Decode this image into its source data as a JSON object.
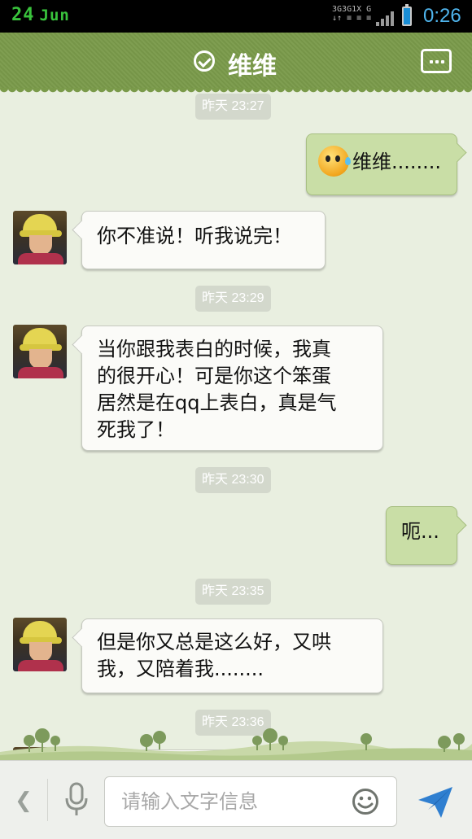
{
  "status_bar": {
    "day": "24",
    "month": "Jun",
    "network": [
      "3G",
      "3G",
      "1X",
      "G"
    ],
    "time": "0:26"
  },
  "header": {
    "title": "维维",
    "verified_icon": "check-circle-icon",
    "menu_icon": "more-dots-icon"
  },
  "messages": [
    {
      "type": "timestamp",
      "text": "昨天 23:27"
    },
    {
      "type": "out",
      "text": "维维........",
      "emoji": "sweat-face-emoji"
    },
    {
      "type": "in",
      "text": "你不准说！听我说完！"
    },
    {
      "type": "timestamp",
      "text": "昨天 23:29"
    },
    {
      "type": "in",
      "lines": [
        "当你跟我表白的时候，我真",
        "的很开心！可是你这个笨蛋",
        "居然是在qq上表白，真是气",
        "死我了！"
      ]
    },
    {
      "type": "timestamp",
      "text": "昨天 23:30"
    },
    {
      "type": "out",
      "text": "呃..."
    },
    {
      "type": "timestamp",
      "text": "昨天 23:35"
    },
    {
      "type": "in",
      "lines": [
        "但是你又总是这么好，又哄",
        "我，又陪着我........"
      ]
    },
    {
      "type": "timestamp",
      "text": "昨天 23:36"
    }
  ],
  "input_bar": {
    "back_icon": "chevron-left-icon",
    "voice_icon": "microphone-icon",
    "placeholder": "请输入文字信息",
    "emoji_icon": "smiley-icon",
    "send_icon": "send-icon"
  },
  "colors": {
    "header_bg": "#7a9a4a",
    "chat_bg": "#e9efe0",
    "out_bubble": "#c9dea6",
    "in_bubble": "#fbfbf8",
    "accent_blue": "#1a8ed6"
  }
}
